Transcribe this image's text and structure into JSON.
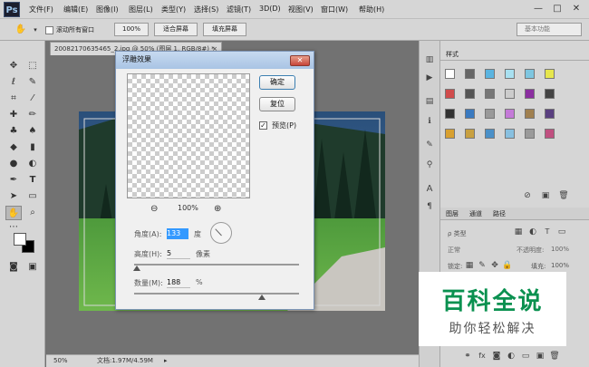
{
  "app": {
    "logo": "Ps"
  },
  "menu": [
    "文件(F)",
    "编辑(E)",
    "图像(I)",
    "图层(L)",
    "类型(Y)",
    "选择(S)",
    "滤镜(T)",
    "3D(D)",
    "视图(V)",
    "窗口(W)",
    "帮助(H)"
  ],
  "window_controls": {
    "minimize": "—",
    "maximize": "□",
    "close": "✕"
  },
  "options": {
    "scroll_all_label": "滚动所有窗口",
    "zoom_btn": "100%",
    "fit_btn": "适合屏幕",
    "fill_btn": "填充屏幕",
    "workspace": "基本功能"
  },
  "document": {
    "tab_title": "20082170635465_2.jpg @ 50% (图层 1, RGB/8#) *",
    "tab_close": "×",
    "zoom_status": "50%",
    "doc_size": "文档:1.97M/4.59M"
  },
  "dialog": {
    "title": "浮雕效果",
    "close": "✕",
    "ok": "确定",
    "reset": "复位",
    "preview_label": "预览(P)",
    "preview_checked": true,
    "zoom_percent": "100%",
    "zoom_out": "⊖",
    "zoom_in": "⊕",
    "angle_label": "角度(A):",
    "angle_value": "133",
    "angle_unit": "度",
    "height_label": "高度(H):",
    "height_value": "5",
    "height_unit": "像素",
    "amount_label": "数量(M):",
    "amount_value": "188",
    "amount_unit": "%"
  },
  "panels": {
    "styles_tab": "样式",
    "layers_tabs": [
      "图层",
      "通道",
      "路径"
    ],
    "kind_label": "ρ 类型",
    "blend_mode": "正常",
    "opacity_label": "不透明度:",
    "opacity_value": "100%",
    "lock_label": "锁定:",
    "fill_label": "填充:",
    "fill_value": "100%"
  },
  "watermark": {
    "title": "百科全说",
    "subtitle": "助你轻松解决"
  },
  "colors": {
    "ui_gray": "#d6d6d6",
    "canvas_gray": "#727272",
    "dialog_title": "#a9c4e4",
    "watermark_green": "#0a9150"
  }
}
